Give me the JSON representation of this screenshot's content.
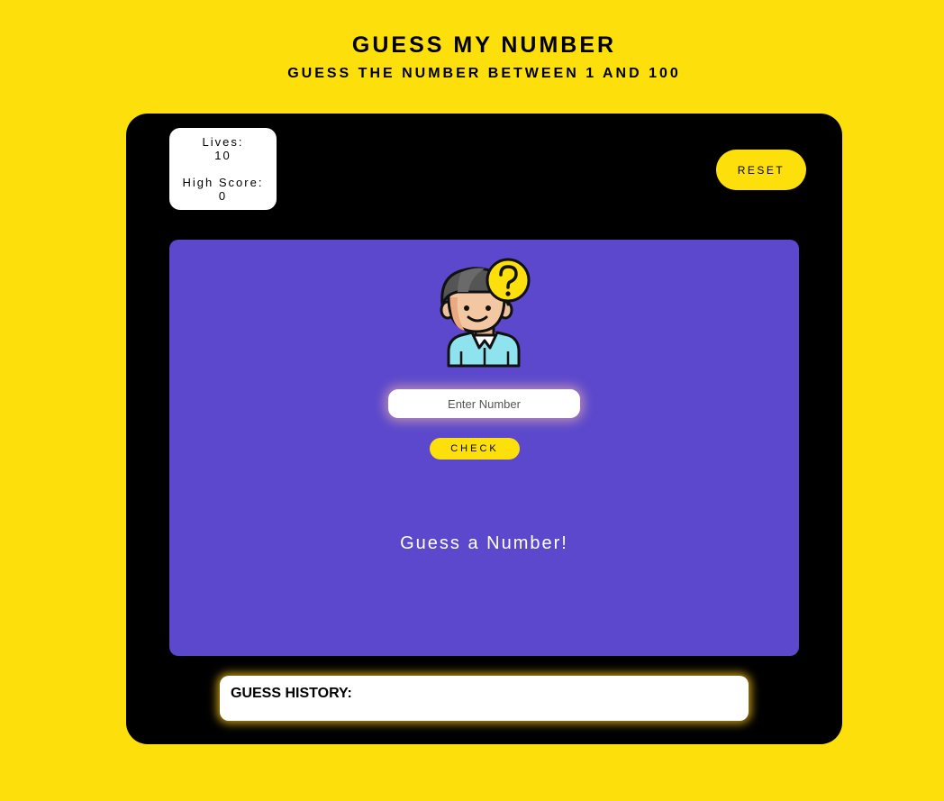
{
  "header": {
    "title": "GUESS MY NUMBER",
    "subtitle": "GUESS THE NUMBER BETWEEN 1 AND 100"
  },
  "stats": {
    "lives_label": "Lives:",
    "lives_value": "10",
    "high_score_label": "High Score:",
    "high_score_value": "0"
  },
  "controls": {
    "reset_label": "RESET",
    "input_placeholder": "Enter Number",
    "input_value": "",
    "check_label": "CHECK"
  },
  "avatar": {
    "icon": "thinking-person-icon"
  },
  "message": "Guess a Number!",
  "history": {
    "title": "GUESS HISTORY:",
    "items": []
  },
  "colors": {
    "background": "#fde00b",
    "panel": "#000000",
    "stage": "#5b48cc",
    "accent": "#fde00b"
  }
}
